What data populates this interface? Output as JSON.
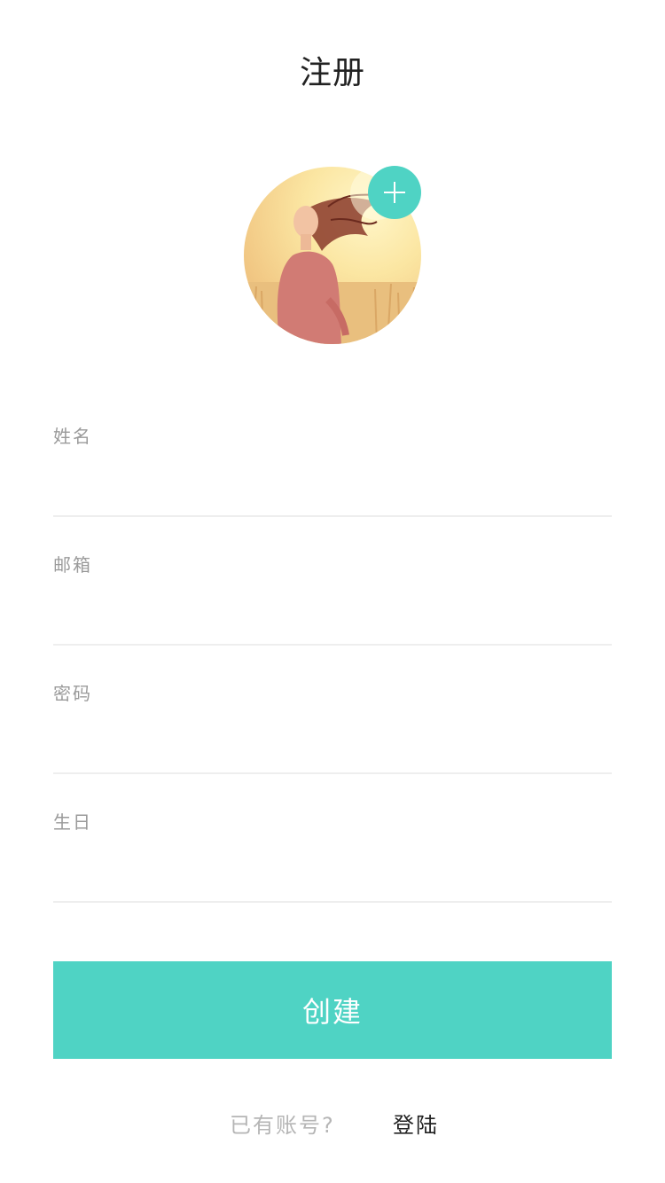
{
  "header": {
    "title": "注册"
  },
  "avatar": {
    "add_icon": "plus-icon"
  },
  "form": {
    "fields": [
      {
        "label": "姓名",
        "value": "",
        "placeholder": ""
      },
      {
        "label": "邮箱",
        "value": "",
        "placeholder": ""
      },
      {
        "label": "密码",
        "value": "",
        "placeholder": ""
      },
      {
        "label": "生日",
        "value": "",
        "placeholder": ""
      }
    ],
    "submit_label": "创建"
  },
  "footer": {
    "hint": "已有账号?",
    "login_label": "登陆"
  },
  "colors": {
    "accent": "#4fd3c4",
    "title_text": "#222222",
    "label_text": "#9a9a9a",
    "divider": "#eeeeee",
    "hint_text": "#b5b5b5"
  }
}
